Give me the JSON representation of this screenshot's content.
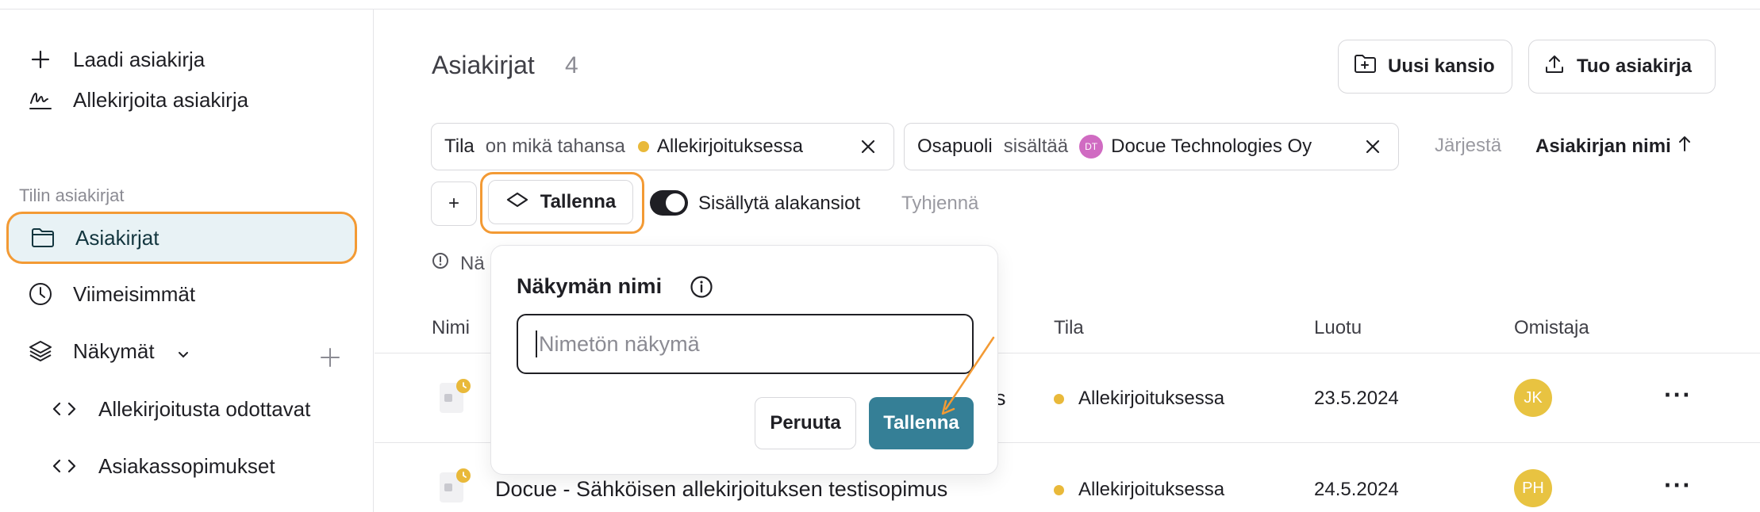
{
  "sidebar": {
    "create_doc": "Laadi asiakirja",
    "sign_doc": "Allekirjoita asiakirja",
    "section_title": "Tilin asiakirjat",
    "documents": "Asiakirjat",
    "recent": "Viimeisimmät",
    "views": "Näkymät",
    "views_items": [
      "Allekirjoitusta odottavat",
      "Asiakassopimukset"
    ]
  },
  "main": {
    "title": "Asiakirjat",
    "count": "4",
    "new_folder_button": "Uusi kansio",
    "import_button": "Tuo asiakirja",
    "filters": [
      {
        "field": "Tila",
        "operator": "on mikä tahansa",
        "value": "Allekirjoituksessa"
      },
      {
        "field": "Osapuoli",
        "operator": "sisältää",
        "value": "Docue Technologies Oy",
        "avatar": "DT"
      }
    ],
    "sort_label": "Järjestä",
    "sort_value": "Asiakirjan nimi",
    "add_filter": "+",
    "save_view_button": "Tallenna",
    "include_subfolders": "Sisällytä alakansiot",
    "include_subfolders_on": true,
    "clear": "Tyhjennä",
    "info_text": "Nä"
  },
  "table": {
    "headers": [
      "Nimi",
      "Tila",
      "Luotu",
      "Omistaja"
    ],
    "rows": [
      {
        "name_visible": "s",
        "status": "Allekirjoituksessa",
        "created": "23.5.2024",
        "owner": "JK"
      },
      {
        "name_visible": "Docue - Sähköisen allekirjoituksen testisopimus",
        "status": "Allekirjoituksessa",
        "created": "24.5.2024",
        "owner": "PH"
      }
    ]
  },
  "popover": {
    "title": "Näkymän nimi",
    "input_value": "",
    "input_placeholder": "Nimetön näkymä",
    "cancel": "Peruuta",
    "save": "Tallenna"
  },
  "colors": {
    "accent": "#357f96",
    "highlight": "#f39a34",
    "status_dot": "#e9b93a",
    "avatar": "#e8c341",
    "dt_avatar": "#d06bc2"
  }
}
